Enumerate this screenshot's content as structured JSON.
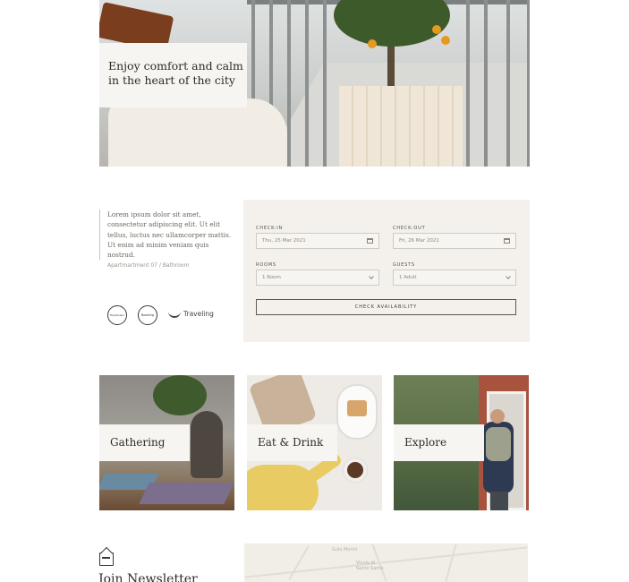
{
  "hero": {
    "caption_line1": "Enjoy comfort and calm",
    "caption_line2": "in the heart of the city"
  },
  "intro": {
    "text": "Lorem ipsum dolor sit amet, consectetur adipiscing elit. Ut elit tellus, luctus nec ullamcorper mattis. Ut enim ad minim veniam quis nostrud.",
    "meta": "Apartmartment 07 / Bathroom"
  },
  "logos": {
    "logo1": "TripAdvisor",
    "logo2": "Booking",
    "logo3": "Traveling"
  },
  "booking": {
    "checkin_label": "Check-in",
    "checkin_value": "Thu, 25 Mar 2021",
    "checkout_label": "Check-out",
    "checkout_value": "Fri, 26 Mar 2021",
    "rooms_label": "Rooms",
    "rooms_value": "1 Room",
    "guests_label": "Guests",
    "guests_value": "1 Adult",
    "button_label": "Check availability"
  },
  "categories": [
    {
      "label": "Gathering"
    },
    {
      "label": "Eat & Drink"
    },
    {
      "label": "Explore"
    }
  ],
  "newsletter": {
    "title": "Join Newsletter"
  },
  "map": {
    "labels": [
      "Gulo Morini",
      "Vicolo di",
      "Santo Santo"
    ]
  },
  "colors": {
    "panel_bg": "#f4f1ec",
    "label_bg": "#f7f5f1",
    "text_dark": "#2e2b28"
  }
}
